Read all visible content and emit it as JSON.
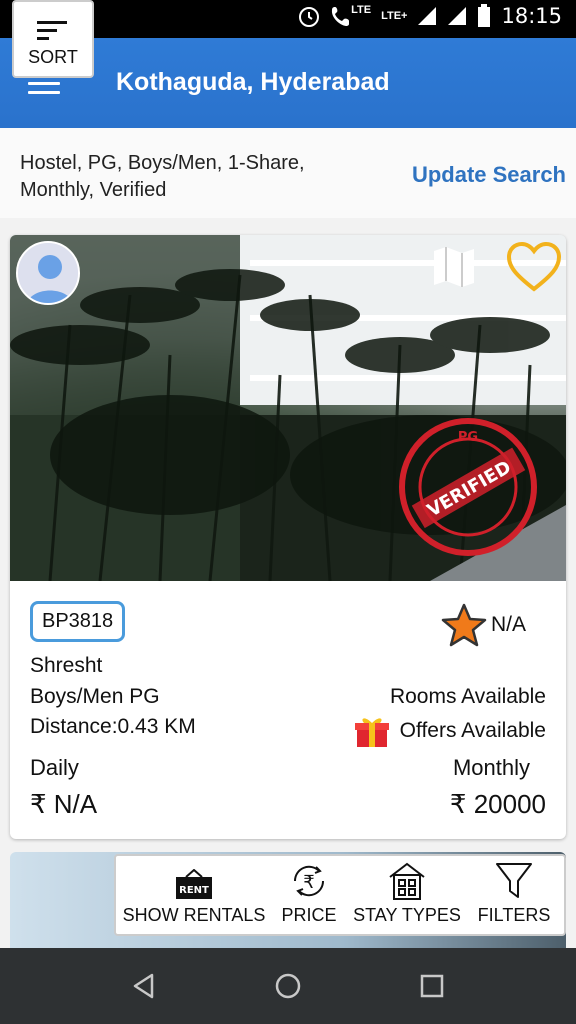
{
  "status_bar": {
    "time": "18:15",
    "lte_label": "LTE",
    "lte_plus_label": "LTE+",
    "icons": [
      "alarm-icon",
      "image-icon",
      "clock-icon",
      "phone-icon",
      "signal-icon",
      "battery-icon"
    ]
  },
  "app_bar": {
    "title": "Kothaguda, Hyderabad",
    "menu_icon": "hamburger-icon"
  },
  "search": {
    "criteria_line1": "Hostel, PG, Boys/Men, 1-Share,",
    "criteria_line2": "Monthly, Verified",
    "update_label": "Update Search"
  },
  "listing": {
    "code": "BP3818",
    "rating": "N/A",
    "name": "Shresht",
    "type": "Boys/Men PG",
    "distance": "Distance:0.43 KM",
    "rooms_status": "Rooms Available",
    "offers_status": "Offers Available",
    "daily_label": "Daily",
    "daily_price": "₹ N/A",
    "monthly_label": "Monthly",
    "monthly_price": "₹ 20000",
    "stamp_text": "VERIFIED",
    "stamp_ring_text": "PG",
    "colors": {
      "badge_border": "#4a9bdc",
      "heart": "#f2b21c",
      "stamp": "#d0202a",
      "star": "#f07a1a"
    }
  },
  "toolbar": {
    "sort_label": "SORT",
    "rentals_label": "SHOW RENTALS",
    "rent_sign_text": "RENT",
    "price_label": "PRICE",
    "stay_types_label": "STAY TYPES",
    "filters_label": "FILTERS"
  },
  "nav_bar": {
    "icons": [
      "back-icon",
      "home-icon",
      "recents-icon"
    ]
  },
  "theme": {
    "primary": "#2f7bd6",
    "link": "#2f73c0"
  }
}
